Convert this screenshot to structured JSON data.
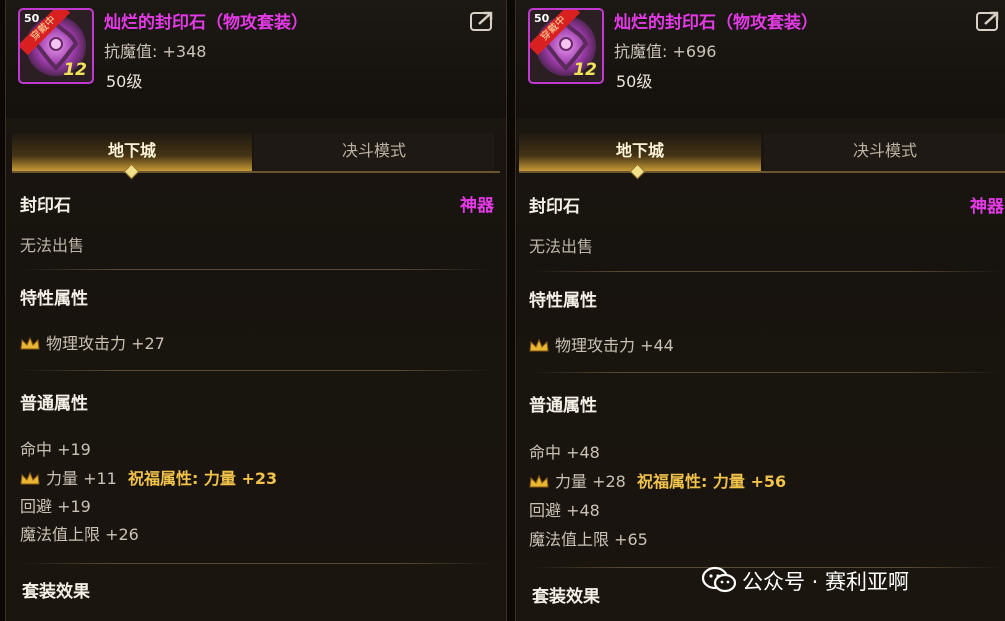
{
  "panels": [
    {
      "item": {
        "corner_num": "50",
        "equipped_tag": "穿戴中",
        "level_badge": "12",
        "name": "灿烂的封印石（物攻套装）",
        "resist": "抗魔值: +348",
        "level": "50级"
      },
      "tabs": [
        "地下城",
        "决斗模式"
      ],
      "category": "封印石",
      "rarity": "神器",
      "sell": "无法出售",
      "special_title": "特性属性",
      "special_stat": "物理攻击力 +27",
      "common_title": "普通属性",
      "common": {
        "hit": "命中 +19",
        "str": "力量 +11",
        "bless": "祝福属性: 力量 +23",
        "evade": "回避 +19",
        "mp": "魔法值上限 +26"
      },
      "set_title": "套装效果"
    },
    {
      "item": {
        "corner_num": "50",
        "equipped_tag": "穿戴中",
        "level_badge": "12",
        "name": "灿烂的封印石（物攻套装）",
        "resist": "抗魔值: +696",
        "level": "50级"
      },
      "tabs": [
        "地下城",
        "决斗模式"
      ],
      "category": "封印石",
      "rarity": "神器",
      "sell": "无法出售",
      "special_title": "特性属性",
      "special_stat": "物理攻击力 +44",
      "common_title": "普通属性",
      "common": {
        "hit": "命中 +48",
        "str": "力量 +28",
        "bless": "祝福属性: 力量 +56",
        "evade": "回避 +48",
        "mp": "魔法值上限 +65"
      },
      "set_title": "套装效果"
    }
  ],
  "watermark": "公众号 · 赛利亚啊",
  "colors": {
    "rarity": "#e33ae6",
    "gold": "#f0c24a",
    "tab_active": "#c69a34"
  }
}
